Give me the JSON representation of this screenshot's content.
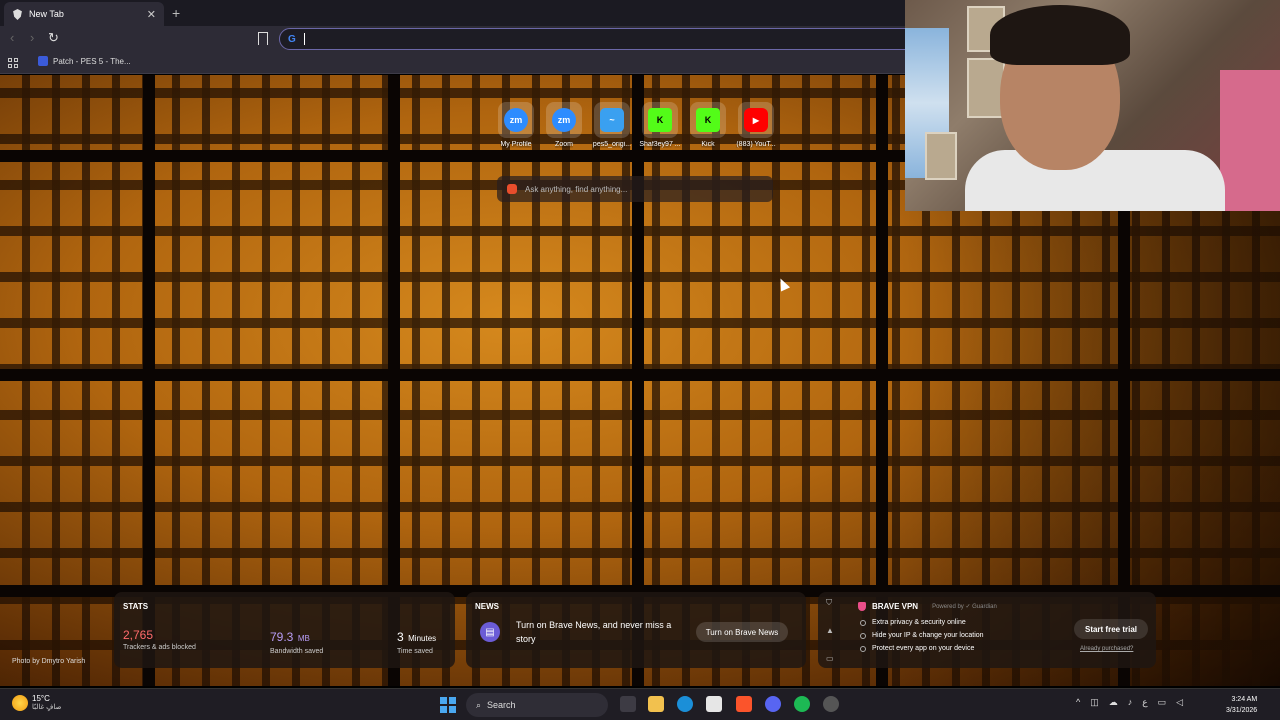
{
  "browser": {
    "tab_title": "New Tab",
    "bookmark_label": "Patch - PES 5 - The...",
    "search_engine_letter": "G"
  },
  "top_sites": [
    {
      "label": "My Profile",
      "glyph": "zm",
      "color": "#2d8cff"
    },
    {
      "label": "Zoom",
      "glyph": "zm",
      "color": "#2d8cff"
    },
    {
      "label": "pes5_origi...",
      "glyph": "~",
      "color": "#3aa0f0"
    },
    {
      "label": "Shaf3ey97 ...",
      "glyph": "K",
      "color": "#53fc18"
    },
    {
      "label": "Kick",
      "glyph": "K",
      "color": "#53fc18"
    },
    {
      "label": "(883) YouT...",
      "glyph": "▶",
      "color": "#ff0000"
    }
  ],
  "ask_placeholder": "Ask anything, find anything...",
  "photo_credit": "Photo by Dmytro Yarish",
  "stats": {
    "title": "STATS",
    "trackers": {
      "value": "2,765",
      "caption": "Trackers & ads blocked",
      "color": "#ff6b6b"
    },
    "bandwidth": {
      "value": "79.3",
      "unit": "MB",
      "caption": "Bandwidth saved",
      "color": "#b79cf5"
    },
    "time": {
      "value": "3",
      "unit": "Minutes",
      "caption": "Time saved"
    }
  },
  "news": {
    "title": "NEWS",
    "text": "Turn on Brave News, and never miss a story",
    "button": "Turn on Brave News"
  },
  "vpn": {
    "brand": "BRAVE VPN",
    "powered": "Powered by ✓ Guardian",
    "features": [
      "Extra privacy & security online",
      "Hide your IP & change your location",
      "Protect every app on your device"
    ],
    "button": "Start free trial",
    "link": "Already purchased?"
  },
  "taskbar": {
    "temp": "15°C",
    "weather_text": "صافٍ غالبًا",
    "search": "Search",
    "time": "3:24 AM",
    "date": "3/31/2026",
    "lang": "ع"
  }
}
